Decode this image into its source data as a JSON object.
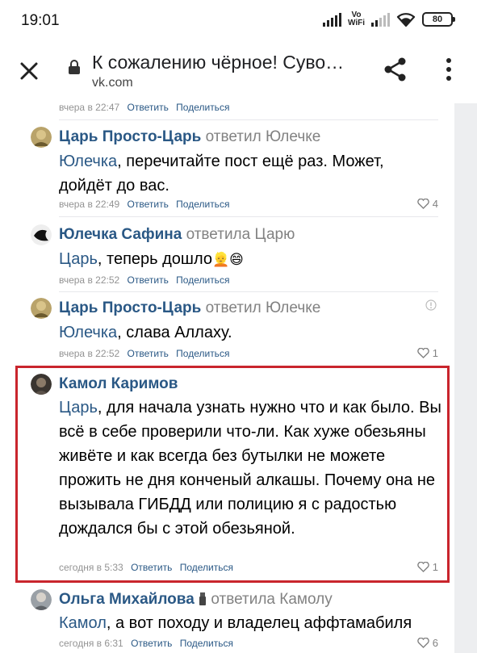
{
  "status_bar": {
    "time": "19:01",
    "vowifi_line1": "Vo",
    "vowifi_line2": "WiFi",
    "battery": "80"
  },
  "browser": {
    "title": "К сожалению чёрное! Суво…",
    "url": "vk.com",
    "icons": [
      "close-icon",
      "lock-icon",
      "share-icon",
      "more-icon"
    ]
  },
  "colors": {
    "author": "#2a5885",
    "meta": "#939393",
    "highlight_border": "#c9252d"
  },
  "comments": [
    {
      "meta_time": "вчера в 22:47",
      "reply": "Ответить",
      "share": "Поделиться"
    },
    {
      "author": "Царь Просто-Царь",
      "action": "ответил Юлечке",
      "mention": "Юлечка",
      "text": ", перечитайте пост ещё раз. Может, дойдёт до вас.",
      "meta_time": "вчера в 22:49",
      "reply": "Ответить",
      "share": "Поделиться",
      "likes": "4"
    },
    {
      "author": "Юлечка Сафина",
      "action": "ответила Царю",
      "mention": "Царь",
      "text": ", теперь дошло",
      "emoji": "👱😄",
      "meta_time": "вчера в 22:52",
      "reply": "Ответить",
      "share": "Поделиться"
    },
    {
      "author": "Царь Просто-Царь",
      "action": "ответил Юлечке",
      "mention": "Юлечка",
      "text": ", слава Аллаху.",
      "meta_time": "вчера в 22:52",
      "reply": "Ответить",
      "share": "Поделиться",
      "likes": "1"
    },
    {
      "author": "Камол Каримов",
      "mention": "Царь",
      "text": ", для начала узнать нужно что и как было. Вы всё в себе проверили что-ли. Как хуже обезьяны живёте и как всегда без бутылки не можете прожить не дня конченый алкашы. Почему она не вызывала ГИБДД или полицию я с радостью дождался бы с этой обезьяной.",
      "meta_time": "сегодня в 5:33",
      "reply": "Ответить",
      "share": "Поделиться",
      "likes": "1"
    },
    {
      "author": "Ольга Михайлова",
      "action": "ответила Камолу",
      "mention": "Камол",
      "text": ", а вот походу и владелец аффтамабиля",
      "meta_time": "сегодня в 6:31",
      "reply": "Ответить",
      "share": "Поделиться",
      "likes": "6"
    }
  ]
}
